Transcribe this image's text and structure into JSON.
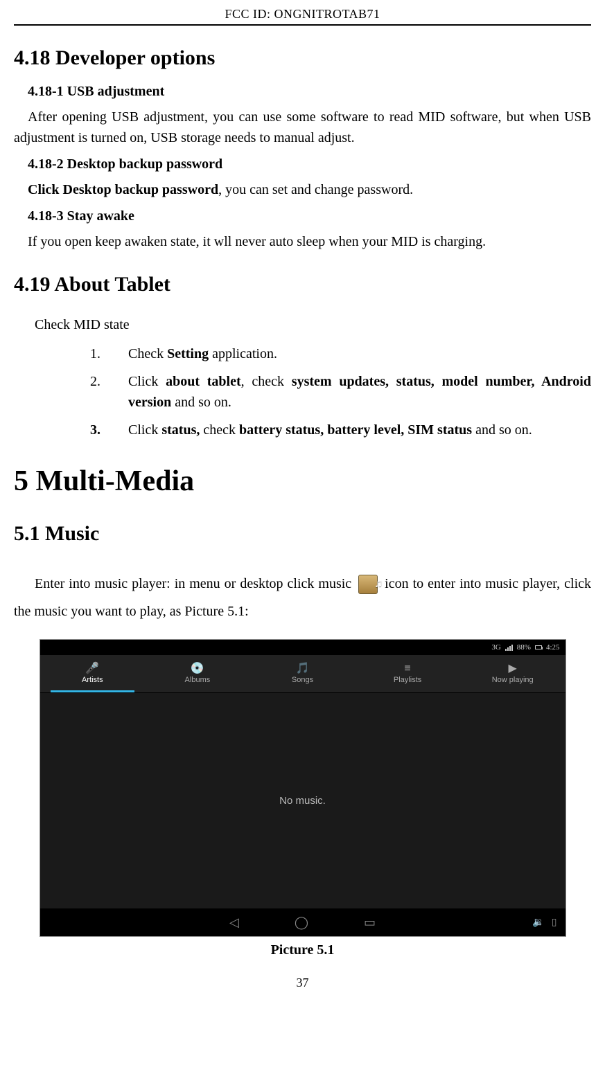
{
  "header": "FCC ID: ONGNITROTAB71",
  "sec418": {
    "title": "4.18 Developer options",
    "usb": {
      "heading": "4.18-1 USB adjustment",
      "text": "After opening USB adjustment, you can use some software to read MID software, but when USB adjustment is turned on, USB storage needs to manual adjust."
    },
    "desktop": {
      "heading": "4.18-2 Desktop backup password",
      "bold_lead": "Click Desktop backup password",
      "rest": ", you can set and change password."
    },
    "stay": {
      "heading": "4.18-3 Stay awake",
      "text": "If you open keep awaken state, it wll never auto sleep when your MID is charging."
    }
  },
  "sec419": {
    "title": "4.19 About Tablet",
    "check_mid": "Check MID state",
    "steps": [
      {
        "num": "1.",
        "pre": "Check ",
        "bold1": "Setting",
        "mid1": " application.",
        "bold2": "",
        "mid2": "",
        "bold3": "",
        "tail": ""
      },
      {
        "num": "2.",
        "pre": "Click ",
        "bold1": "about tablet",
        "mid1": ", check ",
        "bold2": "system updates, status, model number, Android version",
        "mid2": " and so on.",
        "bold3": "",
        "tail": ""
      },
      {
        "num": "3.",
        "pre": "Click ",
        "bold1": "status,",
        "mid1": " check ",
        "bold2": "battery status, battery level, SIM status",
        "mid2": " and so on.",
        "bold3": "",
        "tail": ""
      }
    ]
  },
  "chapter5": {
    "title": "5 Multi-Media",
    "sec51": {
      "title": "5.1 Music",
      "para_pre": "Enter into music player: in menu or desktop click music ",
      "para_post": " icon to enter into music player, click the music you want to play, as Picture 5.1:"
    }
  },
  "screenshot": {
    "status": {
      "network": "3G",
      "battery": "88%",
      "time": "4:25"
    },
    "tabs": [
      "Artists",
      "Albums",
      "Songs",
      "Playlists",
      "Now playing"
    ],
    "tab_icons": [
      "🎤",
      "💿",
      "🎵",
      "≡",
      "▶"
    ],
    "active_tab": 0,
    "body_text": "No music.",
    "nav": {
      "back": "◁",
      "home": "◯",
      "recent": "▭"
    }
  },
  "picture_caption": "Picture 5.1",
  "page_number": "37"
}
